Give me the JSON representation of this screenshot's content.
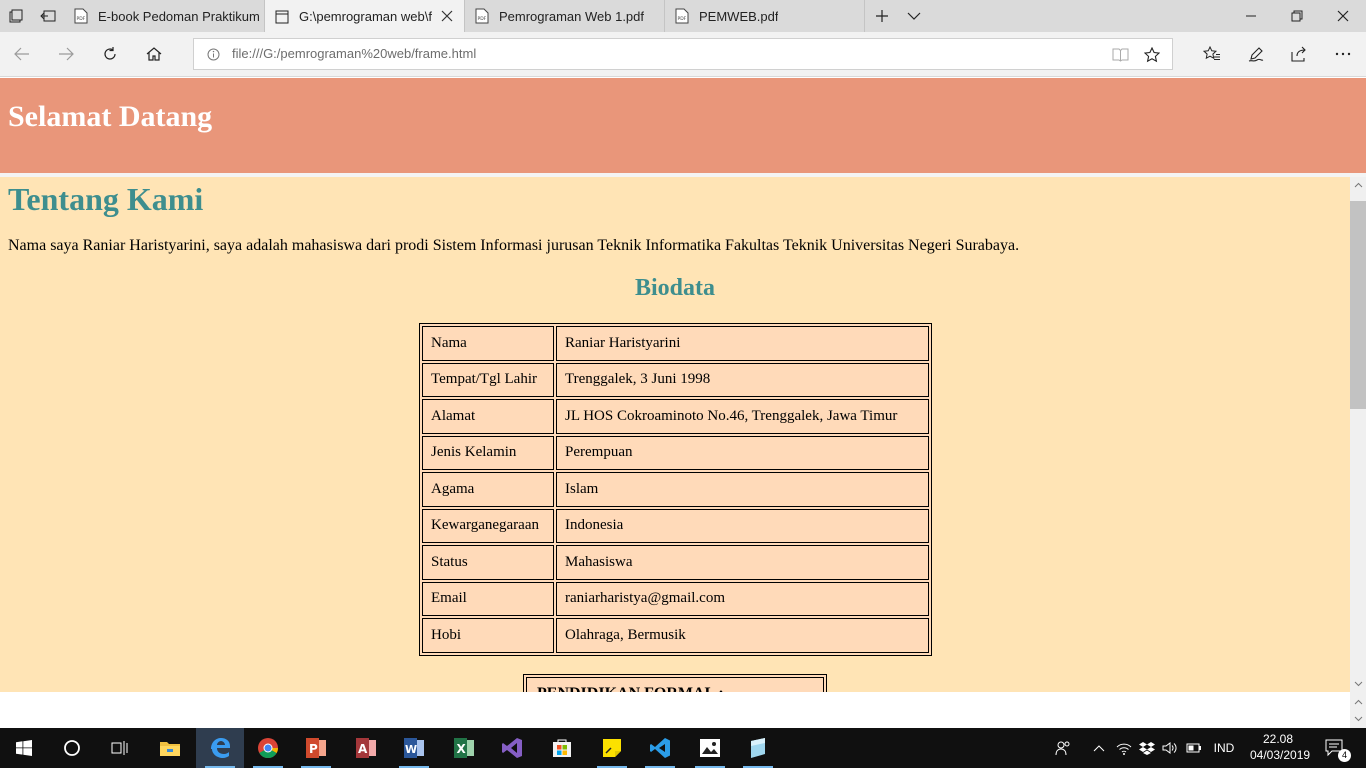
{
  "browser": {
    "tabs": [
      {
        "title": "E-book Pedoman Praktikum",
        "icon": "pdf-icon",
        "active": false
      },
      {
        "title": "G:\\pemrograman web\\f",
        "icon": "page-icon",
        "active": true
      },
      {
        "title": "Pemrograman Web 1.pdf",
        "icon": "pdf-icon",
        "active": false
      },
      {
        "title": "PEMWEB.pdf",
        "icon": "pdf-icon",
        "active": false
      }
    ],
    "address": "file:///G:/pemrograman%20web/frame.html"
  },
  "page": {
    "header_frame": {
      "title": "Selamat Datang",
      "background": "#e9967a"
    },
    "main_frame": {
      "background": "#ffe4b5",
      "heading": "Tentang Kami",
      "heading_color": "#3e8e8e",
      "intro": "Nama saya Raniar Haristyarini, saya adalah mahasiswa dari prodi Sistem Informasi jurusan Teknik Informatika Fakultas Teknik Universitas Negeri Surabaya.",
      "biodata_heading": "Biodata",
      "biodata": [
        {
          "label": "Nama",
          "value": "Raniar Haristyarini"
        },
        {
          "label": "Tempat/Tgl Lahir",
          "value": "Trenggalek, 3 Juni 1998"
        },
        {
          "label": "Alamat",
          "value": "JL HOS Cokroaminoto No.46, Trenggalek, Jawa Timur"
        },
        {
          "label": "Jenis Kelamin",
          "value": "Perempuan"
        },
        {
          "label": "Agama",
          "value": "Islam"
        },
        {
          "label": "Kewarganegaraan",
          "value": "Indonesia"
        },
        {
          "label": "Status",
          "value": "Mahasiswa"
        },
        {
          "label": "Email",
          "value": "raniarharistya@gmail.com"
        },
        {
          "label": "Hobi",
          "value": "Olahraga, Bermusik"
        }
      ],
      "table_background": "#ffdab9",
      "education_heading": "PENDIDIKAN FORMAL :"
    }
  },
  "taskbar": {
    "apps": [
      {
        "name": "file-explorer-icon",
        "running": false
      },
      {
        "name": "edge-icon",
        "running": true,
        "active": true
      },
      {
        "name": "chrome-icon",
        "running": true
      },
      {
        "name": "powerpoint-icon",
        "running": true
      },
      {
        "name": "access-icon",
        "running": false
      },
      {
        "name": "word-icon",
        "running": true
      },
      {
        "name": "excel-icon",
        "running": false
      },
      {
        "name": "visual-studio-icon",
        "running": false
      },
      {
        "name": "store-icon",
        "running": false
      },
      {
        "name": "sticky-notes-icon",
        "running": true
      },
      {
        "name": "vscode-icon",
        "running": true
      },
      {
        "name": "photos-icon",
        "running": true
      },
      {
        "name": "app-icon",
        "running": true
      }
    ],
    "language": "IND",
    "time": "22.08",
    "date": "04/03/2019",
    "notification_count": "4"
  }
}
